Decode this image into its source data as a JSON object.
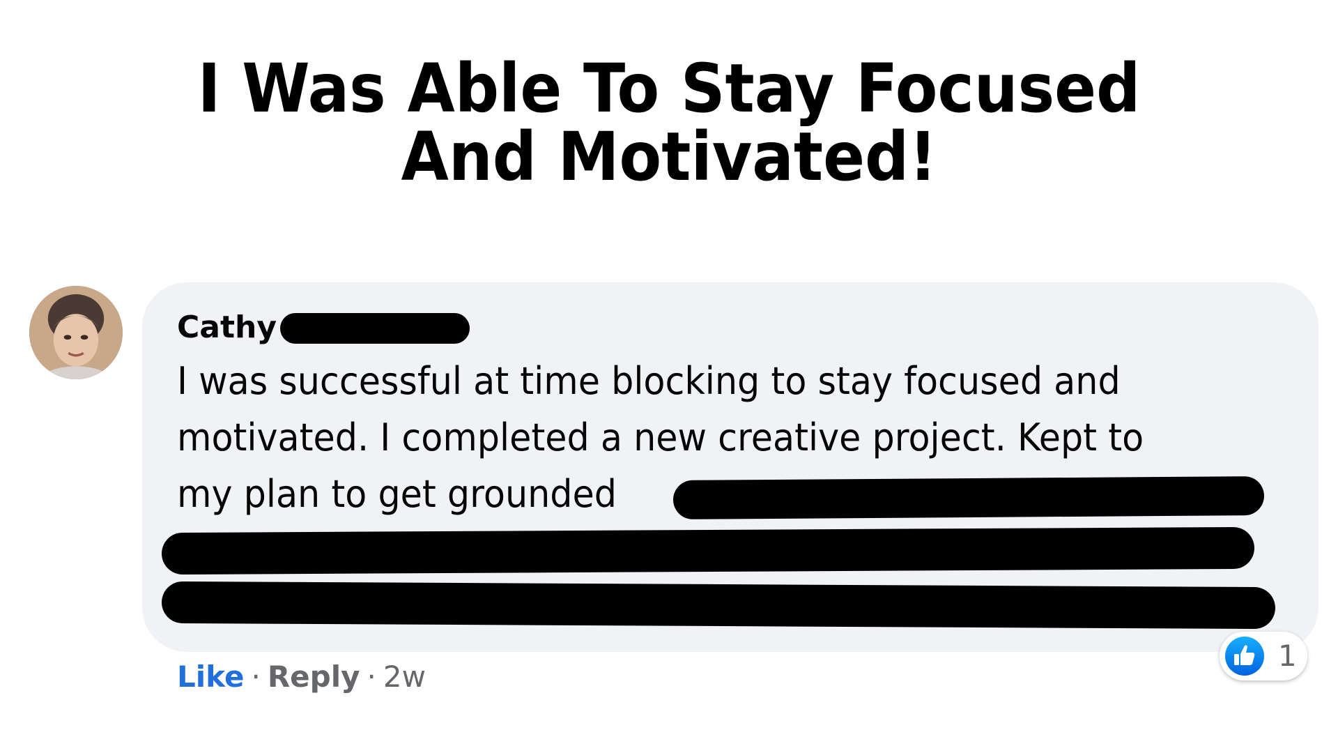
{
  "headline": {
    "line1": "I Was Able To Stay Focused",
    "line2": "And Motivated!"
  },
  "comment": {
    "author": "Cathy",
    "lines": [
      "I was successful at time blocking to stay focused and",
      "motivated. I completed a new creative project. Kept to",
      "my plan to get grounded"
    ],
    "actions": {
      "like": "Like",
      "reply": "Reply",
      "time": "2w",
      "separator": "·"
    },
    "reactions": {
      "icon": "thumbs-up-icon",
      "count": "1"
    }
  },
  "colors": {
    "bubble": "#f0f2f5",
    "like": "#216fdb",
    "meta": "#65676b",
    "reaction_blue": "#1877f2"
  }
}
